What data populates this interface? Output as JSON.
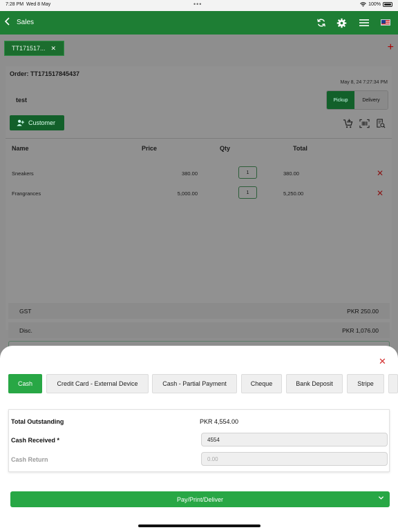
{
  "status_bar": {
    "time": "7:28 PM",
    "date": "Wed 8 May",
    "battery": "100%"
  },
  "header": {
    "title": "Sales",
    "icons": [
      "back-chevron-icon",
      "sync-icon",
      "gear-icon",
      "menu-icon",
      "us-flag-icon"
    ],
    "brand_color": "#1e7e34"
  },
  "order_tab": {
    "label": "TT171517...",
    "close": "✕"
  },
  "order": {
    "number_label": "Order: TT171517845437",
    "datetime": "May 8, 24  7:27:34 PM",
    "customer_name": "test",
    "mode_options": [
      "Pickup",
      "Delivery"
    ],
    "mode_selected": "Pickup",
    "customer_button": "Customer"
  },
  "items_table": {
    "headers": [
      "Name",
      "Price",
      "Qty",
      "Total"
    ],
    "rows": [
      {
        "name": "Sneakers",
        "price": "380.00",
        "qty": "1",
        "total": "380.00"
      },
      {
        "name": "Frangrances",
        "price": "5,000.00",
        "qty": "1",
        "total": "5,250.00"
      }
    ]
  },
  "summary": [
    {
      "label": "GST",
      "value": "PKR 250.00"
    },
    {
      "label": "Disc.",
      "value": "PKR 1,076.00"
    }
  ],
  "payment_sheet": {
    "methods": [
      "Cash",
      "Credit Card - External Device",
      "Cash - Partial Payment",
      "Cheque",
      "Bank Deposit",
      "Stripe"
    ],
    "selected_method": "Cash",
    "total_outstanding_label": "Total Outstanding",
    "total_outstanding_value": "PKR 4,554.00",
    "cash_received_label": "Cash Received *",
    "cash_received_value": "4554",
    "cash_return_label": "Cash Return",
    "cash_return_placeholder": "0.00",
    "action_button": "Pay/Print/Deliver",
    "accent_color": "#28a745",
    "close_color": "#d32f2f"
  }
}
